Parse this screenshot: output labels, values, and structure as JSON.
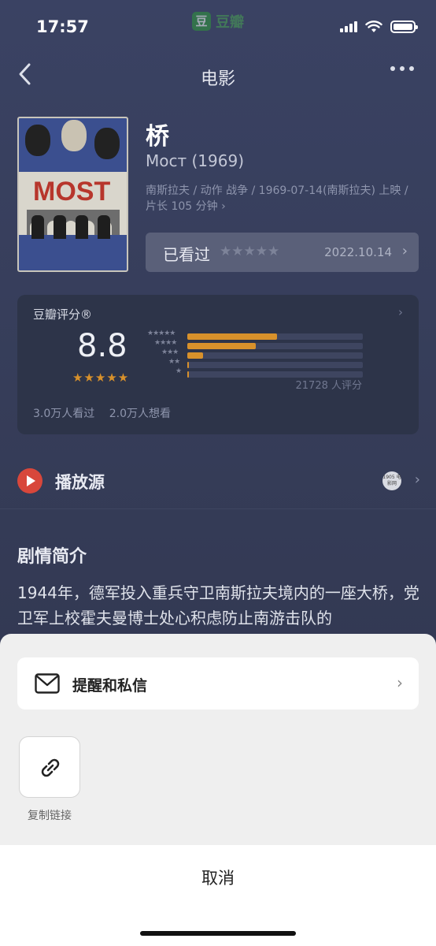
{
  "status_bar": {
    "time": "17:57",
    "app_badge_icon": "豆",
    "app_badge_name": "豆瓣"
  },
  "nav": {
    "title": "电影"
  },
  "movie": {
    "poster_text": "MOST",
    "title": "桥",
    "original_title": "Мост (1969)",
    "meta": "南斯拉夫 / 动作 战争 / 1969-07-14(南斯拉夫) 上映 / 片长 105 分钟 ›"
  },
  "watched": {
    "label": "已看过",
    "stars": "★★★★★",
    "date": "2022.10.14",
    "chevron": "›"
  },
  "rating": {
    "header": "豆瓣评分®",
    "chevron": "›",
    "score": "8.8",
    "score_stars": "★★★★★",
    "star_labels": [
      "★★★★★",
      "★★★★",
      "★★★",
      "★★",
      "★"
    ],
    "distribution_percent": [
      51,
      39,
      9,
      1,
      1
    ],
    "count": "21728 人评分",
    "watched_count": "3.0万人看过",
    "want_count": "2.0万人想看"
  },
  "source": {
    "label": "播放源",
    "provider": "1905 电影网",
    "chevron": "›"
  },
  "synopsis": {
    "heading": "剧情简介",
    "text": "1944年，德军投入重兵守卫南斯拉夫境内的一座大桥，党卫军上校霍夫曼博士处心积虑防止南游击队的"
  },
  "sheet": {
    "message_label": "提醒和私信",
    "message_chevron": "›",
    "copy_link_label": "复制链接",
    "cancel_label": "取消"
  },
  "colors": {
    "accent_orange": "#d8912b",
    "play_red": "#d8473b",
    "page_bg": "#363d59"
  }
}
